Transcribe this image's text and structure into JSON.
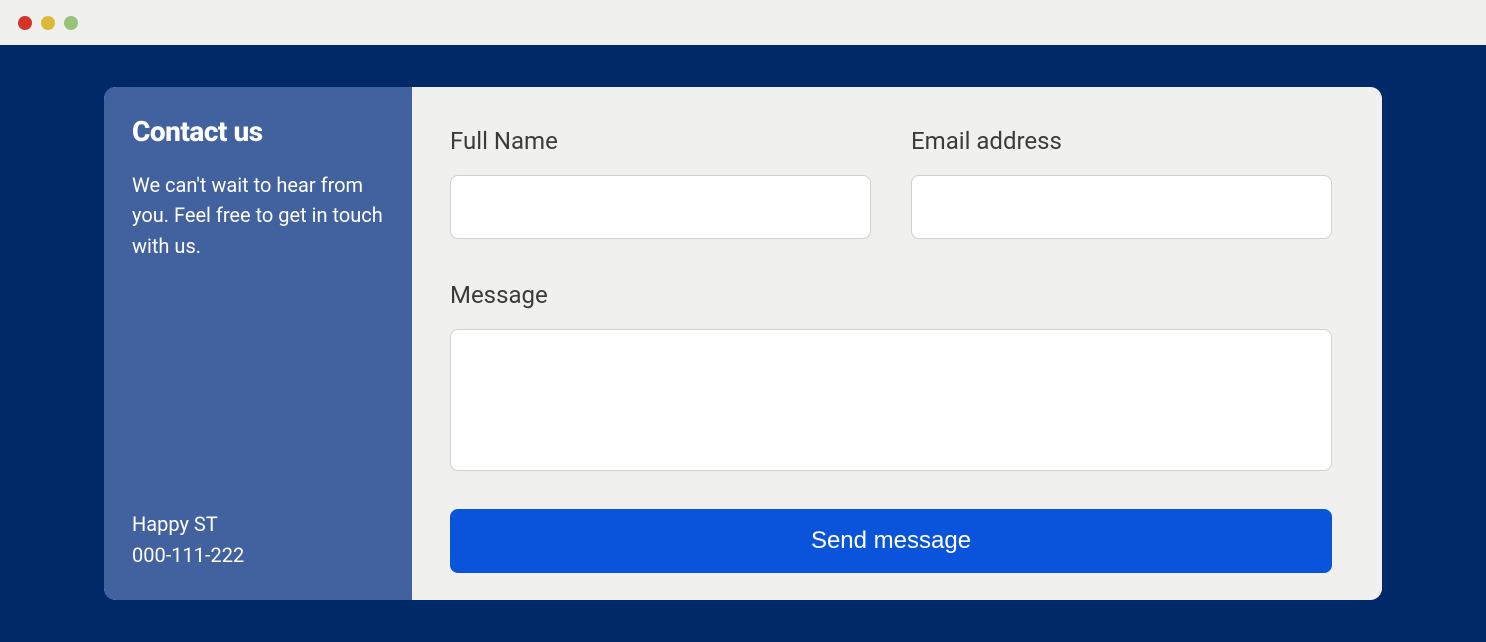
{
  "sidebar": {
    "title": "Contact us",
    "description": "We can't wait to hear from you. Feel free to get in touch with us.",
    "address": "Happy ST",
    "phone": "000-111-222"
  },
  "form": {
    "fields": {
      "full_name": {
        "label": "Full Name",
        "value": ""
      },
      "email": {
        "label": "Email address",
        "value": ""
      },
      "message": {
        "label": "Message",
        "value": ""
      }
    },
    "submit_label": "Send message"
  }
}
